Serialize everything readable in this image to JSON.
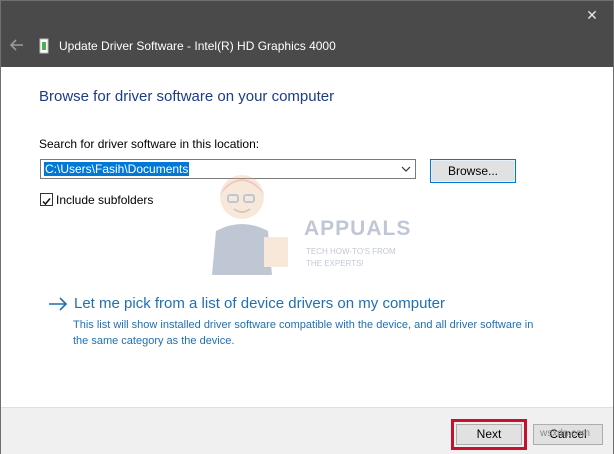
{
  "window": {
    "title": "Update Driver Software - Intel(R) HD Graphics 4000",
    "back_icon": "back-arrow-icon",
    "close_icon": "close-icon",
    "close_glyph": "✕"
  },
  "main": {
    "heading": "Browse for driver software on your computer",
    "search_label": "Search for driver software in this location:",
    "path_value": "C:\\Users\\Fasih\\Documents",
    "browse_label": "Browse...",
    "include_subfolders": {
      "label": "Include subfolders",
      "checked": true
    },
    "pick_option": {
      "title": "Let me pick from a list of device drivers on my computer",
      "description": "This list will show installed driver software compatible with the device, and all driver software in the same category as the device."
    }
  },
  "watermark": {
    "brand": "APPUALS",
    "line1": "TECH HOW-TO'S FROM",
    "line2": "THE EXPERTS!"
  },
  "footer": {
    "next_label": "Next",
    "cancel_label": "Cancel"
  },
  "site_watermark": "wsxdn.com",
  "colors": {
    "title_bar": "#4a4a4a",
    "heading": "#1c3c86",
    "link": "#1f6fb5",
    "selection": "#0078d7",
    "highlight_box": "#c8102e"
  }
}
